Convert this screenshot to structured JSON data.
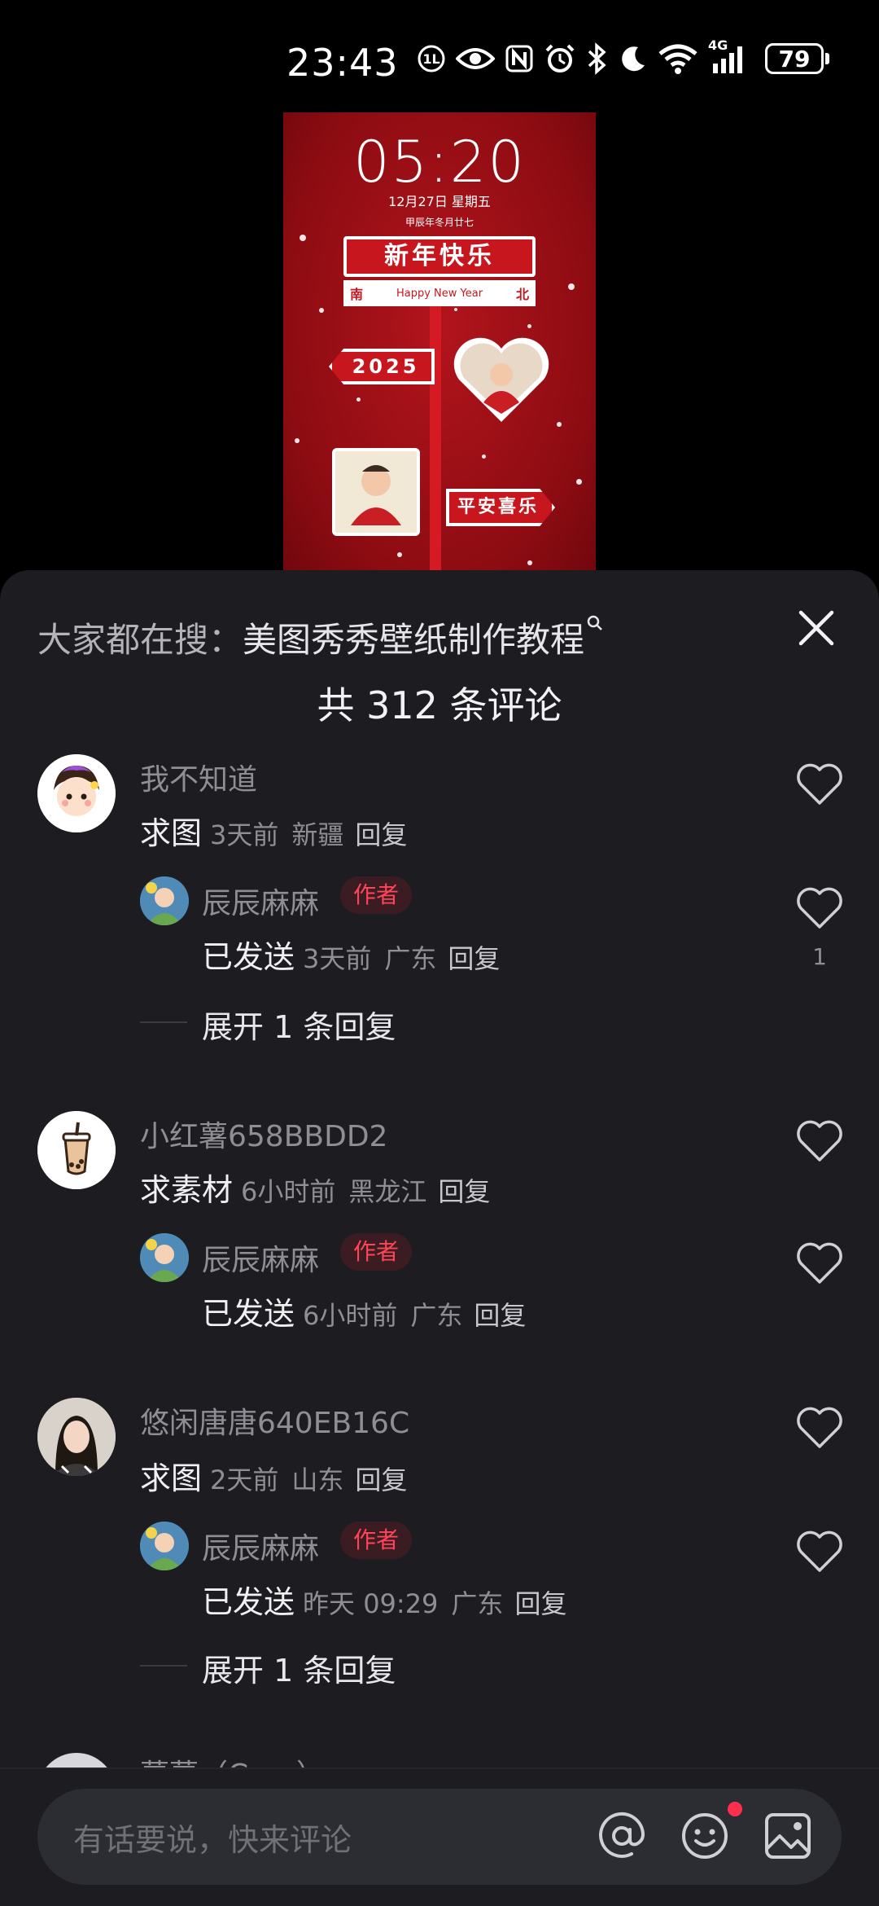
{
  "status_bar": {
    "time": "23:43",
    "network": "4G",
    "battery": "79",
    "icons": [
      "nfc-icon",
      "eye-icon",
      "nfc-n-icon",
      "alarm-icon",
      "bluetooth-icon",
      "moon-icon",
      "wifi-icon",
      "cellular-signal-icon",
      "battery-icon"
    ]
  },
  "wallpaper_preview": {
    "time": "05:20",
    "date": "12月27日  星期五",
    "lunar": "甲辰年冬月廿七",
    "sign_title": "新年快乐",
    "sign_left": "南",
    "sign_sub": "Happy New Year",
    "sign_right": "北",
    "year_sign": "2025",
    "peace_sign": "平安喜乐"
  },
  "sheet": {
    "search_prefix": "大家都在搜：",
    "search_keyword": "美图秀秀壁纸制作教程",
    "title": "共 312 条评论"
  },
  "comments": [
    {
      "user": "我不知道",
      "text": "求图",
      "time": "3天前",
      "location": "新疆",
      "reply_label": "回复",
      "replies": [
        {
          "user": "辰辰麻麻",
          "badge": "作者",
          "text": "已发送",
          "time": "3天前",
          "location": "广东",
          "reply_label": "回复",
          "likes": "1"
        }
      ],
      "expand_label": "展开 1 条回复"
    },
    {
      "user": "小红薯658BBDD2",
      "text": "求素材",
      "time": "6小时前",
      "location": "黑龙江",
      "reply_label": "回复",
      "replies": [
        {
          "user": "辰辰麻麻",
          "badge": "作者",
          "text": "已发送",
          "time": "6小时前",
          "location": "广东",
          "reply_label": "回复"
        }
      ]
    },
    {
      "user": "悠闲唐唐640EB16C",
      "text": "求图",
      "time": "2天前",
      "location": "山东",
      "reply_label": "回复",
      "replies": [
        {
          "user": "辰辰麻麻",
          "badge": "作者",
          "text": "已发送",
          "time": "昨天 09:29",
          "location": "广东",
          "reply_label": "回复"
        }
      ],
      "expand_label": "展开 1 条回复"
    },
    {
      "user": "蕾蕾（Cara）"
    }
  ],
  "input_bar": {
    "placeholder": "有话要说，快来评论",
    "icons": [
      "at-icon",
      "emoji-icon",
      "image-icon"
    ]
  },
  "colors": {
    "sheet_bg": "#1c1c21",
    "author_badge": "#ff4458",
    "notif_dot": "#ff2e4d",
    "wallpaper_red": "#b3141c"
  }
}
